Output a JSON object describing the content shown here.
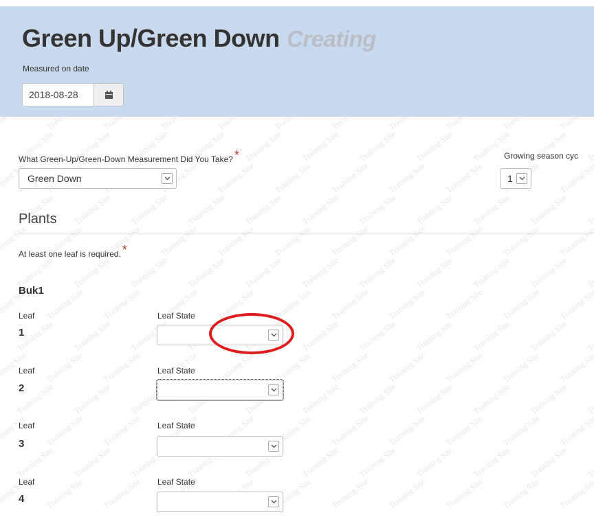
{
  "header": {
    "title": "Green Up/Green Down",
    "status": "Creating",
    "measured_label": "Measured on date",
    "date_value": "2018-08-28",
    "calendar_icon": "calendar-icon"
  },
  "watermark_text": "Training Site",
  "form": {
    "measurement_label": "What Green-Up/Green-Down Measurement Did You Take?",
    "measurement_value": "Green Down",
    "season_label": "Growing season cyc",
    "season_value": "1",
    "required_mark": "*"
  },
  "plants": {
    "heading": "Plants",
    "requirement_note": "At least one leaf is required.",
    "plant_name": "Buk1",
    "leaf_label": "Leaf",
    "leaf_state_label": "Leaf State",
    "leaves": [
      {
        "number": "1",
        "state": ""
      },
      {
        "number": "2",
        "state": ""
      },
      {
        "number": "3",
        "state": ""
      },
      {
        "number": "4",
        "state": ""
      }
    ]
  },
  "colors": {
    "header_bg": "#c9d9ee",
    "required": "#c0392b",
    "annotation_ring": "#e01b1b"
  }
}
